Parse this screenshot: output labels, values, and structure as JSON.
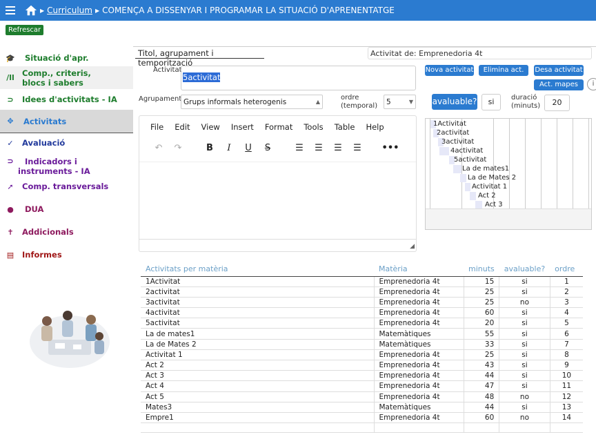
{
  "breadcrumb": {
    "link": "Curriculum",
    "current": "COMENÇA A DISSENYAR I PROGRAMAR LA SITUACIÓ D'APRENENTATGE"
  },
  "refresh_label": "Refrescar",
  "sidebar": {
    "items": [
      {
        "label": "Situació d'apr.",
        "icon": "graduation-cap-icon",
        "color": "#1e7d2d"
      },
      {
        "label": "Comp., criteris,",
        "label2": "blocs i sabers",
        "icon": "books-icon",
        "color": "#1e7d2d"
      },
      {
        "label": "Idees d'activitats - IA",
        "icon": "lightbulb-icon",
        "color": "#1e7d2d"
      },
      {
        "label": "Activitats",
        "icon": "move-arrows-icon",
        "color": "#2b7bd0"
      },
      {
        "label": "Avaluació",
        "icon": "check-double-icon",
        "color": "#223a9c"
      },
      {
        "label": "Indicadors i",
        "label2": "instruments - IA",
        "icon": "lightbulb-icon",
        "color": "#6a1b9a"
      },
      {
        "label": "Comp. transversals",
        "icon": "arrow-square-icon",
        "color": "#6a1b9a"
      },
      {
        "label": "DUA",
        "icon": "brain-icon",
        "color": "#8e1a5e"
      },
      {
        "label": "Addicionals",
        "icon": "person-icon",
        "color": "#8e1a5e"
      },
      {
        "label": "Informes",
        "icon": "document-icon",
        "color": "#a01818"
      }
    ]
  },
  "form": {
    "panel_title": "Titol, agrupament i temporització",
    "activitat_de": "Activitat de: Emprenedoria 4t",
    "activitat_label": "Activitat",
    "activitat_value": "5activitat",
    "agrupament_label": "Agrupament",
    "agrupament_value": "Grups informals heterogenis",
    "ordre_label_1": "ordre",
    "ordre_label_2": "(temporal)",
    "ordre_value": "5",
    "avaluable_button": "avaluable?",
    "avaluable_value": "si",
    "durada_label_1": "duració",
    "durada_label_2": "(minuts)",
    "durada_value": "20",
    "circle_button": "i"
  },
  "buttons": {
    "nova": "Nova activitat",
    "elimina": "Elimina act.",
    "desa": "Desa activitat",
    "mapes": "Act. mapes"
  },
  "editor": {
    "menu": [
      "File",
      "Edit",
      "View",
      "Insert",
      "Format",
      "Tools",
      "Table",
      "Help"
    ]
  },
  "gantt": {
    "items": [
      "1Activitat",
      "2activitat",
      "3activitat",
      "4activitat",
      "5activitat",
      "La de mates1",
      "La de Mates 2",
      "Activitat 1",
      "Act 2",
      "Act 3"
    ]
  },
  "table": {
    "headers": [
      "Activitats per matèria",
      "Matèria",
      "minuts",
      "avaluable?",
      "ordre"
    ],
    "rows": [
      [
        "1Activitat",
        "Emprenedoria 4t",
        "15",
        "si",
        "1"
      ],
      [
        "2activitat",
        "Emprenedoria 4t",
        "25",
        "si",
        "2"
      ],
      [
        "3activitat",
        "Emprenedoria 4t",
        "25",
        "no",
        "3"
      ],
      [
        "4activitat",
        "Emprenedoria 4t",
        "60",
        "si",
        "4"
      ],
      [
        "5activitat",
        "Emprenedoria 4t",
        "20",
        "si",
        "5"
      ],
      [
        "La de mates1",
        "Matemàtiques",
        "55",
        "si",
        "6"
      ],
      [
        "La de Mates 2",
        "Matemàtiques",
        "33",
        "si",
        "7"
      ],
      [
        "Activitat 1",
        "Emprenedoria 4t",
        "25",
        "si",
        "8"
      ],
      [
        "Act 2",
        "Emprenedoria 4t",
        "43",
        "si",
        "9"
      ],
      [
        "Act 3",
        "Emprenedoria 4t",
        "44",
        "si",
        "10"
      ],
      [
        "Act 4",
        "Emprenedoria 4t",
        "47",
        "si",
        "11"
      ],
      [
        "Act 5",
        "Emprenedoria 4t",
        "48",
        "no",
        "12"
      ],
      [
        "Mates3",
        "Matemàtiques",
        "44",
        "si",
        "13"
      ],
      [
        "Empre1",
        "Emprenedoria 4t",
        "60",
        "no",
        "14"
      ]
    ]
  }
}
